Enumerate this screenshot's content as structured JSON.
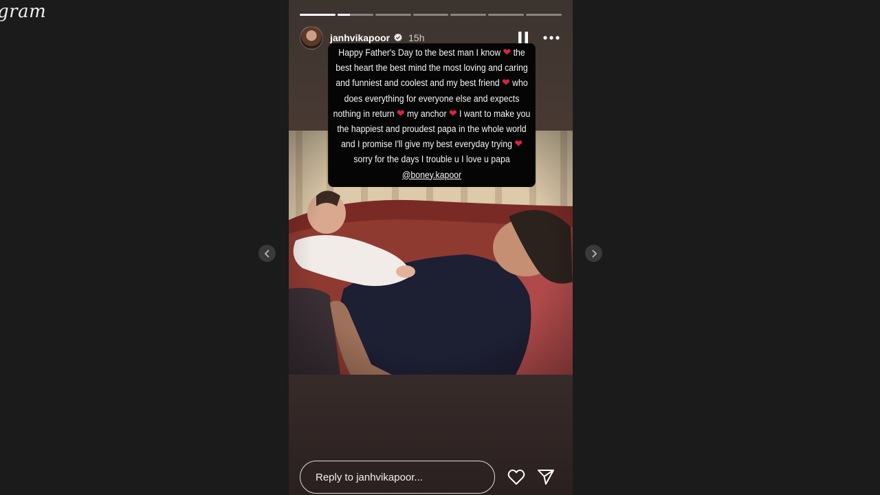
{
  "app": {
    "brand_text": "gram"
  },
  "story": {
    "progress": {
      "segments": 7,
      "active_index": 1,
      "active_fraction": 0.35
    },
    "header": {
      "username": "janhvikapoor",
      "verified": true,
      "time": "15h"
    },
    "caption": {
      "parts": [
        "Happy Father's Day to the best man I know ",
        " the best heart the best mind the most loving and caring and funniest and coolest and my best friend ",
        " who does everything for everyone else and expects nothing in return ",
        " my anchor ",
        " I want to make you the happiest and proudest papa in the whole world and I promise I'll give my best everyday trying ",
        " sorry for the days I trouble u I love u papa "
      ],
      "heart_glyph": "❤",
      "mention": "@boney.kapoor"
    },
    "reply": {
      "placeholder": "Reply to janhvikapoor..."
    }
  },
  "icons": {
    "prev": "chevron-left-icon",
    "next": "chevron-right-icon",
    "pause": "pause-icon",
    "more": "more-icon",
    "like": "heart-icon",
    "share": "send-icon",
    "verified": "verified-badge-icon"
  },
  "colors": {
    "page_bg": "#1b1b1b",
    "heart_red": "#e0213f",
    "caption_bg": "#050505"
  }
}
